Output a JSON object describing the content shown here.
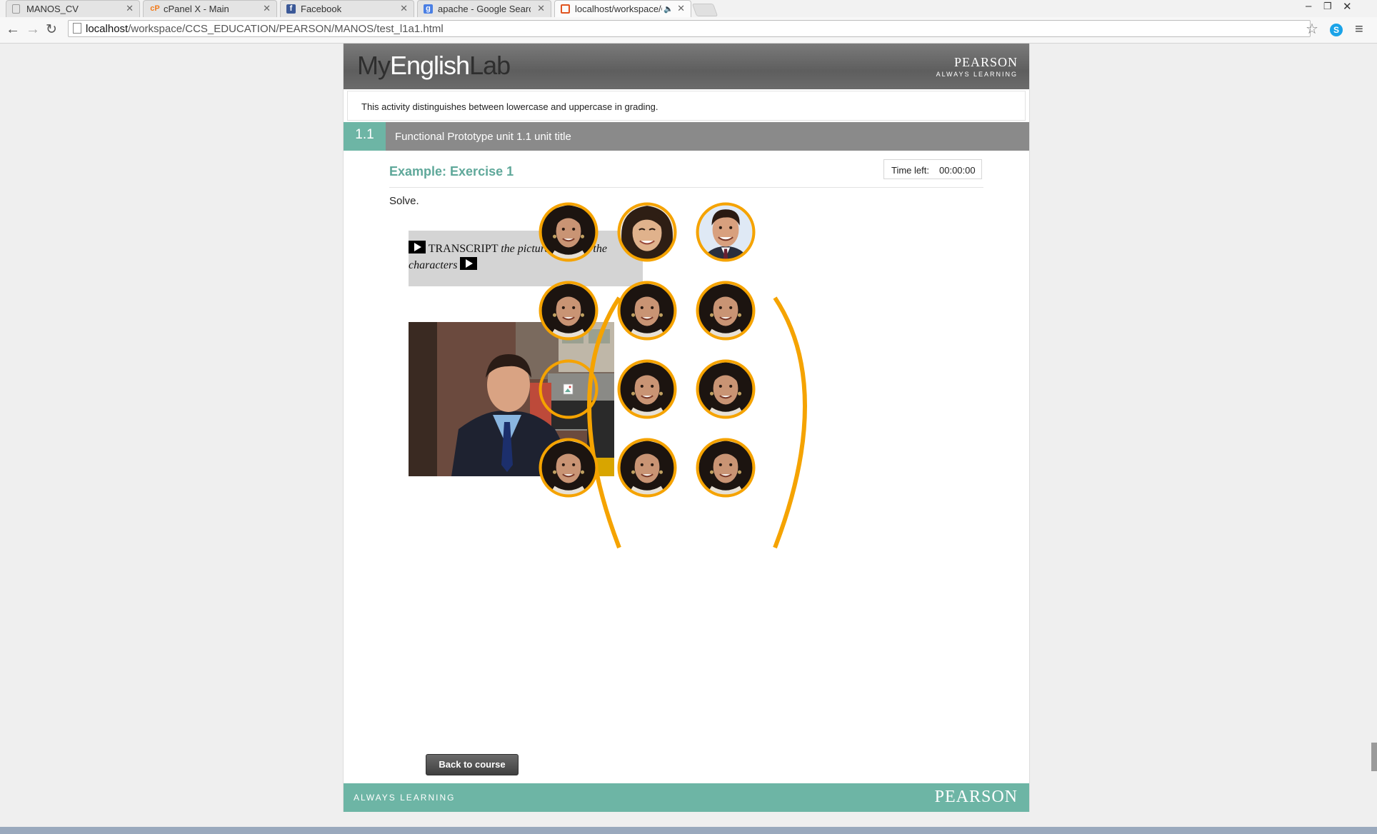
{
  "browser": {
    "tabs": [
      {
        "label": "MANOS_CV",
        "icon": "page-icon",
        "active": false
      },
      {
        "label": "cPanel X - Main",
        "icon": "cpanel-icon",
        "active": false
      },
      {
        "label": "Facebook",
        "icon": "facebook-icon",
        "active": false
      },
      {
        "label": "apache - Google Search",
        "icon": "google-icon",
        "active": false
      },
      {
        "label": "localhost/workspace/C",
        "icon": "html-file-icon",
        "active": true,
        "audio": true
      }
    ],
    "url_host": "localhost",
    "url_path": "/workspace/CCS_EDUCATION/PEARSON/MANOS/test_l1a1.html",
    "icons": [
      "back-arrow-icon",
      "forward-arrow-icon",
      "reload-icon",
      "star-icon",
      "skype-icon",
      "menu-icon"
    ]
  },
  "header": {
    "brand_my": "My",
    "brand_english": "English",
    "brand_lab": "Lab",
    "publisher": "PEARSON",
    "tagline": "ALWAYS LEARNING"
  },
  "notice": "This activity distinguishes between lowercase and uppercase in grading.",
  "unit": {
    "number": "1.1",
    "title": "Functional Prototype unit 1.1 unit title"
  },
  "exercise": {
    "title": "Example: Exercise 1",
    "timer_label": "Time left:",
    "timer_value": "00:00:00",
    "instruction": "Solve."
  },
  "transcript": {
    "label": "TRANSCRIPT",
    "text": "the pictures to meet the characters"
  },
  "colors": {
    "accent_teal": "#6db5a5",
    "ring_orange": "#f5a300",
    "header_gray": "#6b6b6b"
  },
  "faces": [
    {
      "row": 1,
      "col": 1,
      "person": "woman-dark-hair"
    },
    {
      "row": 1,
      "col": 2,
      "person": "woman-asian"
    },
    {
      "row": 1,
      "col": 3,
      "person": "man-suit"
    },
    {
      "row": 2,
      "col": 1,
      "person": "woman-dark-hair"
    },
    {
      "row": 2,
      "col": 2,
      "person": "woman-dark-hair"
    },
    {
      "row": 2,
      "col": 3,
      "person": "woman-dark-hair"
    },
    {
      "row": 3,
      "col": 1,
      "person": "broken-image"
    },
    {
      "row": 3,
      "col": 2,
      "person": "woman-dark-hair"
    },
    {
      "row": 3,
      "col": 3,
      "person": "woman-dark-hair"
    },
    {
      "row": 4,
      "col": 1,
      "person": "woman-dark-hair"
    },
    {
      "row": 4,
      "col": 2,
      "person": "woman-dark-hair"
    },
    {
      "row": 4,
      "col": 3,
      "person": "woman-dark-hair"
    }
  ],
  "back_button": "Back to course",
  "footer": {
    "tagline": "ALWAYS LEARNING",
    "publisher": "PEARSON"
  }
}
